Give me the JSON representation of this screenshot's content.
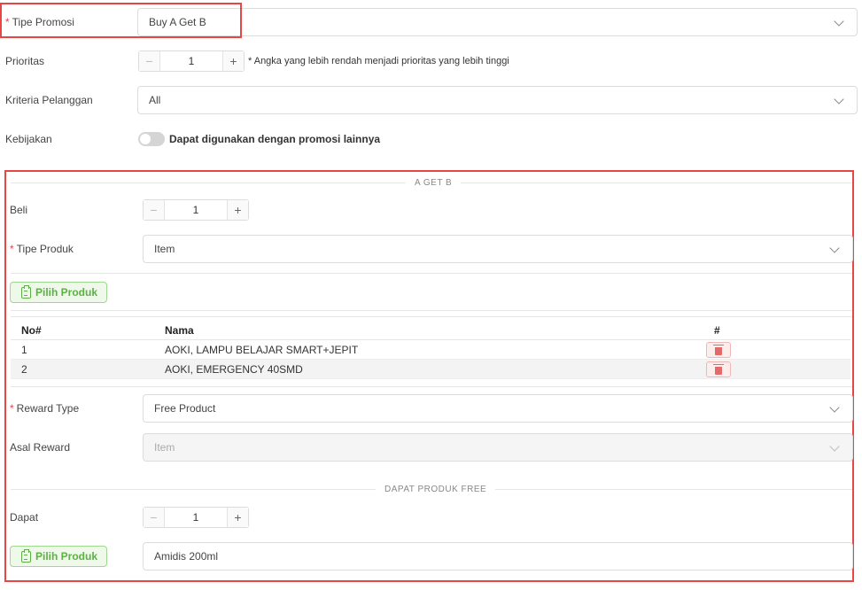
{
  "form": {
    "tipe_promosi": {
      "label": "Tipe Promosi",
      "value": "Buy A Get B"
    },
    "prioritas": {
      "label": "Prioritas",
      "value": "1",
      "hint": "* Angka yang lebih rendah menjadi prioritas yang lebih tinggi"
    },
    "kriteria": {
      "label": "Kriteria Pelanggan",
      "value": "All"
    },
    "kebijakan": {
      "label": "Kebijakan",
      "toggle_label": "Dapat digunakan dengan promosi lainnya",
      "enabled": false
    }
  },
  "section_a": {
    "title": "A GET B",
    "beli": {
      "label": "Beli",
      "value": "1"
    },
    "tipe_produk": {
      "label": "Tipe Produk",
      "value": "Item"
    },
    "pilih_produk_label": "Pilih Produk",
    "table": {
      "headers": [
        "No#",
        "Nama",
        "#"
      ],
      "rows": [
        {
          "no": "1",
          "nama": "AOKI, LAMPU BELAJAR SMART+JEPIT"
        },
        {
          "no": "2",
          "nama": "AOKI, EMERGENCY 40SMD"
        }
      ]
    },
    "reward_type": {
      "label": "Reward Type",
      "value": "Free Product"
    },
    "asal_reward": {
      "label": "Asal Reward",
      "value": "Item"
    }
  },
  "section_b": {
    "title": "DAPAT PRODUK FREE",
    "dapat": {
      "label": "Dapat",
      "value": "1"
    },
    "pilih_produk_label": "Pilih Produk",
    "product_value": "Amidis 200ml"
  },
  "colors": {
    "highlight": "#e84545",
    "green": "#5cb046",
    "required": "#e54545"
  }
}
